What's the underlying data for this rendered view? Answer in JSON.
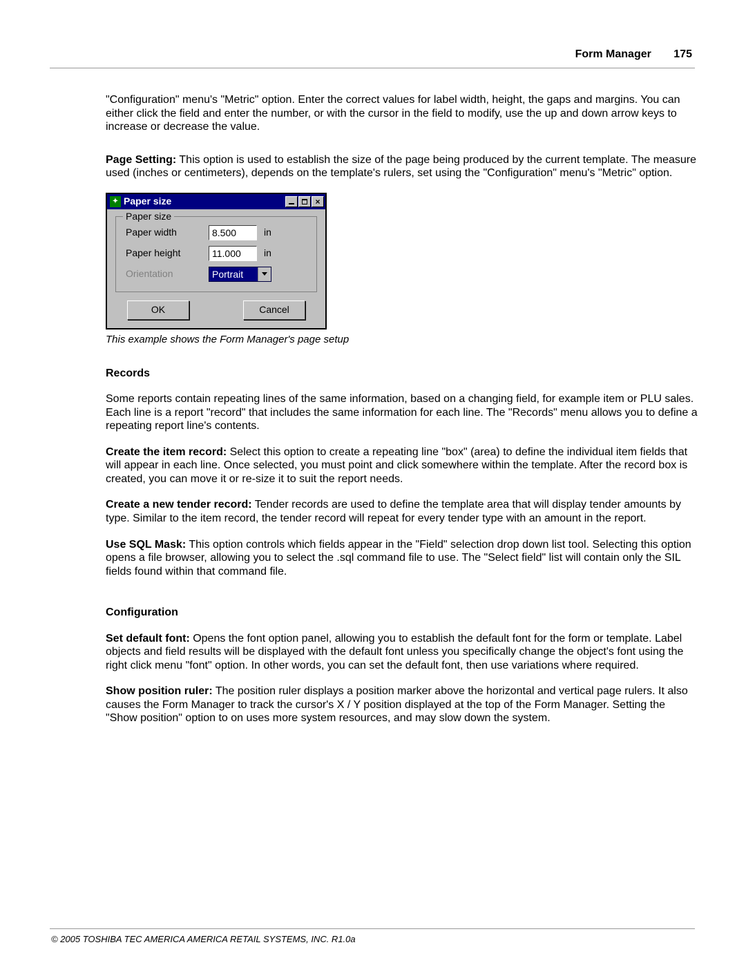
{
  "header": {
    "title": "Form Manager",
    "page": "175"
  },
  "intro_para": "\"Configuration\" menu's \"Metric\" option. Enter the correct values for label width, height, the gaps and margins. You can either click the field and enter the number, or with the cursor in the field to modify, use the up and down arrow keys to increase or decrease the value.",
  "page_setting": {
    "label": "Page Setting:",
    "text": "  This option is used to establish the size of the page being produced by the current template. The measure used (inches or centimeters), depends on the template's rulers, set using the \"Configuration\" menu's \"Metric\" option."
  },
  "dialog": {
    "title": "Paper size",
    "group_legend": "Paper size",
    "rows": {
      "width": {
        "label": "Paper width",
        "value": "8.500",
        "unit": "in"
      },
      "height": {
        "label": "Paper height",
        "value": "11.000",
        "unit": "in"
      },
      "orientation": {
        "label": "Orientation",
        "value": "Portrait"
      }
    },
    "buttons": {
      "ok": "OK",
      "cancel": "Cancel"
    }
  },
  "caption": "This example shows the Form Manager's page setup",
  "records": {
    "heading": "Records",
    "intro": " Some reports contain repeating lines of the same information, based on a changing field, for example item or PLU sales. Each line is a report \"record\" that includes the same information for each line. The \"Records\" menu allows you to define a repeating report line's contents.",
    "item": {
      "label": "Create the item record:",
      "text": "  Select this option to create a repeating line \"box\" (area) to define the individual item fields that will appear in each line. Once selected, you must point and click somewhere within the template. After the record box is created, you can move it or re-size it to suit the report needs."
    },
    "tender": {
      "label": "Create a new tender record:",
      "text": "  Tender records are used to define the template area that will display tender amounts by type. Similar to the item record, the tender record will repeat for every tender type with an amount in the report."
    },
    "sql": {
      "label": "Use SQL Mask:",
      "text": "  This option controls which fields appear in the \"Field\" selection drop down list tool. Selecting this option opens a file browser, allowing you to select the .sql command file to use. The \"Select field\" list will contain only the SIL fields found within that command file."
    }
  },
  "configuration": {
    "heading": "Configuration",
    "font": {
      "label": "Set default font:",
      "text": "  Opens the font option panel, allowing you to establish the default font for the form or template. Label objects and field results will be displayed with the default font unless you specifically change the object's font using the right click menu \"font\" option. In other words, you can set the default font, then use variations where required."
    },
    "ruler": {
      "label": "Show position ruler:",
      "text": "  The position ruler displays a position marker above the horizontal and vertical page rulers. It also causes the Form Manager to track the cursor's X / Y position displayed at the top of the Form Manager. Setting the \"Show position\" option to on uses more system resources, and may slow down the system."
    }
  },
  "footer": "© 2005 TOSHIBA TEC AMERICA AMERICA RETAIL SYSTEMS, INC.   R1.0a"
}
